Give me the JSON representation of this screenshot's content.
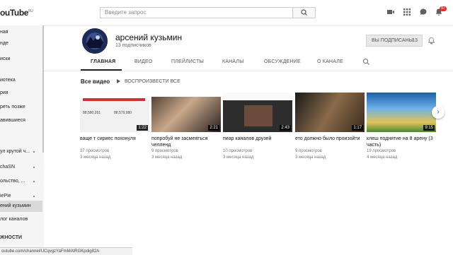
{
  "header": {
    "logo": "ouTube",
    "logo_sup": "RU",
    "search_placeholder": "Введите запрос",
    "notif_count": "9+"
  },
  "sidebar": {
    "items": [
      {
        "label": "ная",
        "dot": false,
        "active": false
      },
      {
        "label": "нде",
        "dot": false,
        "active": false
      },
      {
        "label": "иски",
        "dot": false,
        "active": false
      },
      {
        "label": "иотека",
        "dot": false,
        "active": false
      },
      {
        "label": "рия",
        "dot": false,
        "active": false
      },
      {
        "label": "реть позже",
        "dot": false,
        "active": false
      },
      {
        "label": "авившиеся",
        "dot": false,
        "active": false
      },
      {
        "label": "ул крутой ч...",
        "dot": true,
        "active": false
      },
      {
        "label": "chaSN",
        "dot": true,
        "active": false
      },
      {
        "label": "ольство, ...",
        "dot": true,
        "active": false
      },
      {
        "label": "iePie",
        "dot": true,
        "active": false
      },
      {
        "label": "ений кузьмин",
        "dot": false,
        "active": true
      },
      {
        "label": "лог каналов",
        "dot": false,
        "active": false
      },
      {
        "label": "ЖНОСТИ",
        "dot": false,
        "active": false
      }
    ]
  },
  "channel": {
    "name": "арсений кузьмин",
    "subscribers": "13 подписчиков",
    "subscribed_label": "ВЫ ПОДПИСАНЫ",
    "subscribed_count": "13"
  },
  "tabs": [
    "ГЛАВНАЯ",
    "ВИДЕО",
    "ПЛЕЙЛИСТЫ",
    "КАНАЛЫ",
    "ОБСУЖДЕНИЕ",
    "О КАНАЛЕ"
  ],
  "section": {
    "title": "Все видео",
    "play_all": "ВОСПРОИЗВЕСТИ ВСЕ"
  },
  "videos": [
    {
      "title": "ваще т сириес похонуля",
      "views": "37 просмотров",
      "date": "3 месяца назад",
      "duration": "1:22"
    },
    {
      "title": "попробуй не засмеяться челленд",
      "views": "9 просмотров",
      "date": "3 месяца назад",
      "duration": "2:21"
    },
    {
      "title": "пиар каналов друзей",
      "views": "10 просмотров",
      "date": "3 месяца назад",
      "duration": "2:43"
    },
    {
      "title": "ето должно было произойти",
      "views": "9 просмотров",
      "date": "3 месяца назад",
      "duration": "1:17"
    },
    {
      "title": "клеш поднятие на 8 арену (3 часть)",
      "views": "19 просмотров",
      "date": "4 месяца назад",
      "duration": "9:15"
    }
  ],
  "thumb_texts": {
    "t1_count_a": "88,580,261",
    "t1_count_b": "88,579,980"
  },
  "statusbar": {
    "url": "outube.com/channel/UCqvgzYaFmMAtRGKpdig82A"
  },
  "colors": {
    "accent": "#e52d27",
    "link": "#167ac6"
  }
}
